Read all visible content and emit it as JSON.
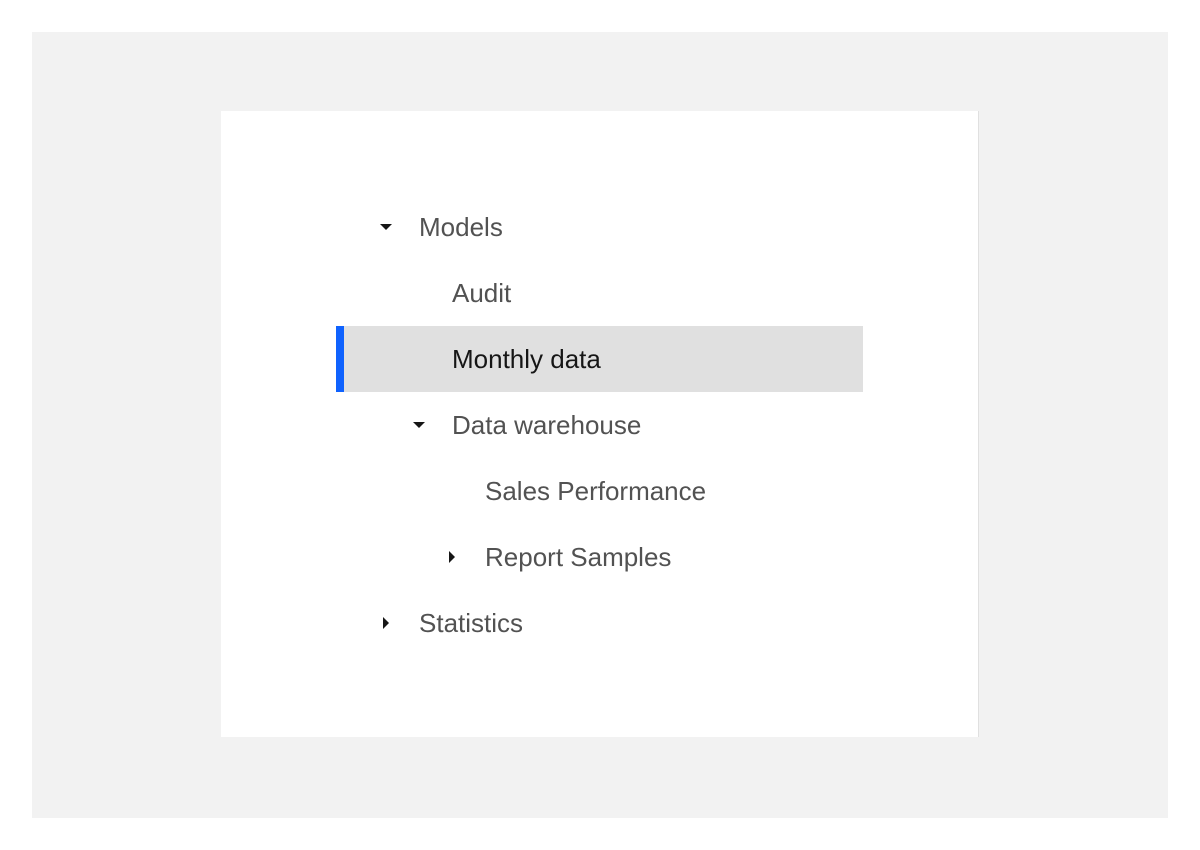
{
  "tree": {
    "nodes": [
      {
        "label": "Models",
        "state": "expanded",
        "icon": "caret-down-icon"
      },
      {
        "label": "Audit"
      },
      {
        "label": "Monthly data",
        "selected": true
      },
      {
        "label": "Data warehouse",
        "state": "expanded",
        "icon": "caret-down-icon"
      },
      {
        "label": "Sales Performance"
      },
      {
        "label": "Report Samples",
        "state": "collapsed",
        "icon": "caret-right-icon"
      },
      {
        "label": "Statistics",
        "state": "collapsed",
        "icon": "caret-right-icon"
      }
    ]
  },
  "colors": {
    "selection_indicator": "#0f62fe",
    "selected_background": "#e0e0e0",
    "outer_background": "#f2f2f2",
    "text": "#525252",
    "text_selected": "#161616"
  }
}
